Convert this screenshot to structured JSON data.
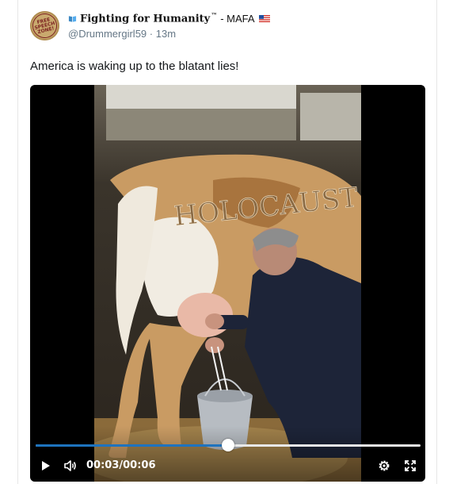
{
  "post": {
    "avatar_text": "FREE SPEECH ZONE!",
    "display_name": "Fighting for Humanity",
    "trademark": "™",
    "name_suffix": "- MAFA",
    "handle": "@Drummergirl59",
    "separator": "·",
    "time_ago": "13m",
    "text": "America is waking up to the blatant lies!",
    "icons": {
      "name_prefix": "open-book-icon",
      "name_end": "us-flag-icon"
    }
  },
  "video": {
    "image_text": "HOLOCAUST",
    "current_time": "00:03",
    "time_separator": "/",
    "duration": "00:06",
    "progress_fraction": 0.5,
    "colors": {
      "progress": "#1e73be",
      "track": "#e8e8e8"
    },
    "controls": [
      "play-icon",
      "volume-icon",
      "settings-icon",
      "fullscreen-icon"
    ]
  }
}
